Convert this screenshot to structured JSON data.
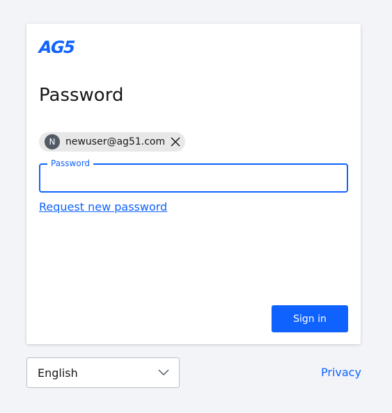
{
  "brand": {
    "logo_text": "AG5",
    "accent_color": "#0f62fe"
  },
  "page": {
    "title": "Password"
  },
  "account_chip": {
    "avatar_initial": "N",
    "email": "newuser@ag51.com",
    "remove_icon": "close-icon"
  },
  "password_field": {
    "label": "Password",
    "value": "",
    "placeholder": ""
  },
  "links": {
    "request_new_password": "Request new password",
    "privacy": "Privacy"
  },
  "actions": {
    "sign_in": "Sign in"
  },
  "language_select": {
    "selected": "English",
    "icon": "chevron-down-icon"
  }
}
